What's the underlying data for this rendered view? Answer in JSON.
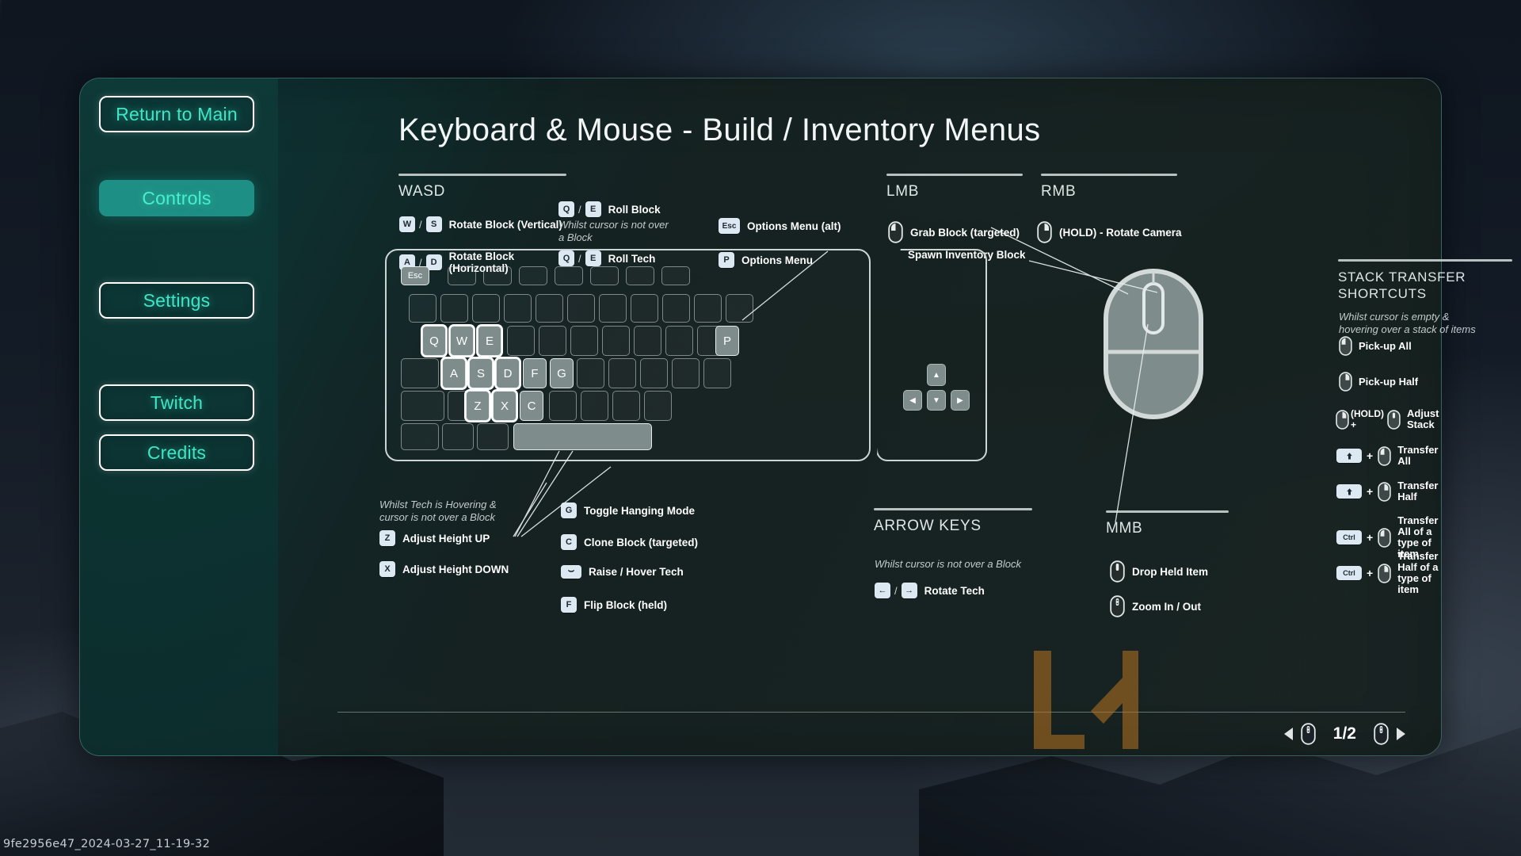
{
  "window": {
    "filename_overlay": "9fe2956e47_2024-03-27_11-19-32"
  },
  "sidebar": {
    "items": [
      {
        "label": "Return to Main",
        "state": "normal"
      },
      {
        "label": "Controls",
        "state": "active"
      },
      {
        "label": "Settings",
        "state": "normal"
      },
      {
        "label": "Twitch",
        "state": "normal"
      },
      {
        "label": "Credits",
        "state": "normal"
      }
    ]
  },
  "header": {
    "title": "Keyboard & Mouse - Build / Inventory Menus"
  },
  "sections": {
    "wasd": {
      "label": "WASD",
      "rows": [
        {
          "keys": [
            "W",
            "S"
          ],
          "separator": "/",
          "text": "Rotate Block (Vertical)"
        },
        {
          "keys": [
            "A",
            "D"
          ],
          "separator": "/",
          "text": "Rotate Block (Horizontal)"
        }
      ]
    },
    "roll": {
      "rows": [
        {
          "keys": [
            "Q",
            "E"
          ],
          "separator": "/",
          "text": "Roll Block"
        },
        {
          "keys": [
            "Q",
            "E"
          ],
          "separator": "/",
          "text": "Roll Tech"
        }
      ],
      "note": "Whilst cursor is not over a Block"
    },
    "options": {
      "rows": [
        {
          "keys": [
            "Esc"
          ],
          "text": "Options Menu (alt)"
        },
        {
          "keys": [
            "P"
          ],
          "text": "Options Menu"
        }
      ]
    },
    "lmb": {
      "label": "LMB",
      "rows": [
        {
          "icon": "mouse-left-icon",
          "text": "Grab Block (targeted)"
        }
      ],
      "subtext": "Spawn Inventory Block"
    },
    "rmb": {
      "label": "RMB",
      "rows": [
        {
          "icon": "mouse-right-icon",
          "text": "(HOLD) - Rotate Camera"
        }
      ]
    },
    "mmb": {
      "label": "MMB",
      "rows": [
        {
          "icon": "mouse-middle-icon",
          "text": "Drop Held Item"
        },
        {
          "icon": "mouse-scroll-icon",
          "text": "Zoom In / Out"
        }
      ]
    },
    "stack_transfer": {
      "label": "STACK TRANSFER SHORTCUTS",
      "note": "Whilst cursor is empty & hovering over a stack of items",
      "rows": [
        {
          "modifier": null,
          "icon": "mouse-left-icon",
          "text": "Pick-up All"
        },
        {
          "modifier": null,
          "icon": "mouse-right-icon",
          "text": "Pick-up Half"
        },
        {
          "modifier": null,
          "icon": "mouse-right-icon",
          "prefix": "(HOLD) +",
          "icon2": "mouse-scroll-icon",
          "text": "Adjust Stack"
        },
        {
          "modifier": "Shift",
          "icon": "mouse-left-icon",
          "text": "Transfer All"
        },
        {
          "modifier": "Shift",
          "icon": "mouse-right-icon",
          "text": "Transfer Half"
        },
        {
          "modifier": "Ctrl",
          "icon": "mouse-left-icon",
          "text": "Transfer All of a type of item"
        },
        {
          "modifier": "Ctrl",
          "icon": "mouse-right-icon",
          "text": "Transfer Half of a type of item"
        }
      ]
    },
    "tech_hover": {
      "note": "Whilst Tech is Hovering & cursor is not over a Block",
      "rows": [
        {
          "keys": [
            "Z"
          ],
          "text": "Adjust Height UP"
        },
        {
          "keys": [
            "X"
          ],
          "text": "Adjust Height DOWN"
        }
      ]
    },
    "block_actions": {
      "rows": [
        {
          "keys": [
            "G"
          ],
          "text": "Toggle Hanging Mode"
        },
        {
          "keys": [
            "C"
          ],
          "text": "Clone Block (targeted)"
        },
        {
          "keys": [
            "Space"
          ],
          "text": "Raise / Hover Tech"
        },
        {
          "keys": [
            "F"
          ],
          "text": "Flip Block (held)"
        }
      ]
    },
    "arrow_keys": {
      "label": "ARROW KEYS",
      "note": "Whilst cursor is not over a Block",
      "rows": [
        {
          "keys": [
            "←",
            "→"
          ],
          "separator": "/",
          "text": "Rotate Tech"
        }
      ]
    }
  },
  "keyboard_diagram": {
    "highlighted_keys": [
      "Esc",
      "Q",
      "W",
      "E",
      "P",
      "A",
      "S",
      "D",
      "F",
      "G",
      "Z",
      "X",
      "C",
      "Space"
    ],
    "ringed_keys": [
      "Q",
      "W",
      "E",
      "A",
      "S",
      "D",
      "Z",
      "X"
    ],
    "arrow_cluster": [
      "▲",
      "◀",
      "▼",
      "▶"
    ]
  },
  "pager": {
    "current": "1/2",
    "prev_icon": "triangle-left-icon",
    "next_icon": "triangle-right-icon"
  },
  "colors": {
    "accent": "#3fe6c6",
    "accent_fill": "#1e8f84",
    "panel_bg": "#16302e",
    "keycap": "#dde9f2",
    "text": "#ffffff",
    "muted": "#c3cbcb",
    "rule": "#b9c0c0"
  }
}
